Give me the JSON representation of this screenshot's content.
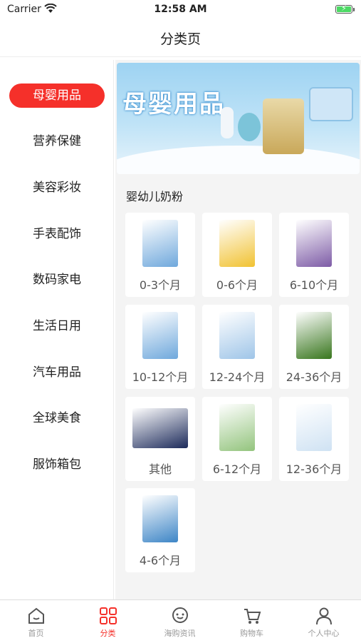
{
  "status": {
    "carrier": "Carrier",
    "time": "12:58 AM"
  },
  "nav": {
    "title": "分类页"
  },
  "sidebar": {
    "items": [
      {
        "label": "母婴用品",
        "active": true
      },
      {
        "label": "营养保健"
      },
      {
        "label": "美容彩妆"
      },
      {
        "label": "手表配饰"
      },
      {
        "label": "数码家电"
      },
      {
        "label": "生活日用"
      },
      {
        "label": "汽车用品"
      },
      {
        "label": "全球美食"
      },
      {
        "label": "服饰箱包"
      }
    ]
  },
  "banner": {
    "title": "母婴用品"
  },
  "section": {
    "title": "婴幼儿奶粉"
  },
  "products": [
    {
      "label": "0-3个月",
      "color": "#6fa8dc"
    },
    {
      "label": "0-6个月",
      "color": "#f1c232"
    },
    {
      "label": "6-10个月",
      "color": "#7d5ba6"
    },
    {
      "label": "10-12个月",
      "color": "#6fa8dc"
    },
    {
      "label": "12-24个月",
      "color": "#9fc5e8"
    },
    {
      "label": "24-36个月",
      "color": "#38761d"
    },
    {
      "label": "其他",
      "color": "#1c2a5a"
    },
    {
      "label": "6-12个月",
      "color": "#93c47d"
    },
    {
      "label": "12-36个月",
      "color": "#cfe2f3"
    },
    {
      "label": "4-6个月",
      "color": "#3d85c6"
    }
  ],
  "tabbar": {
    "items": [
      {
        "label": "首页",
        "icon": "home-icon"
      },
      {
        "label": "分类",
        "icon": "category-icon",
        "active": true
      },
      {
        "label": "海购资讯",
        "icon": "chat-icon"
      },
      {
        "label": "购物车",
        "icon": "cart-icon"
      },
      {
        "label": "个人中心",
        "icon": "person-icon"
      }
    ]
  },
  "colors": {
    "accent": "#f5302a",
    "inactive": "#999999"
  }
}
